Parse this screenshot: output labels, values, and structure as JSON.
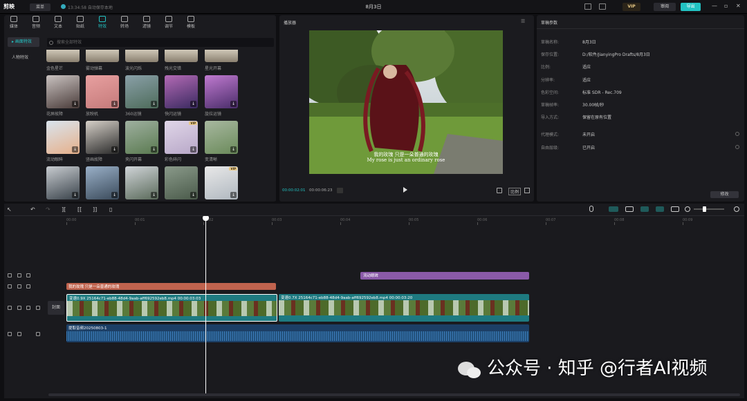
{
  "app": {
    "logo": "剪映",
    "menu_label": "菜单",
    "autosave": "13:34:58 自动保存本地",
    "window_title": "8月3日",
    "vip": "VIP",
    "review": "审阅",
    "export": "导出"
  },
  "top_tabs": [
    {
      "label": "媒体",
      "icon": "media-icon"
    },
    {
      "label": "音频",
      "icon": "audio-icon"
    },
    {
      "label": "文本",
      "icon": "text-icon"
    },
    {
      "label": "贴纸",
      "icon": "sticker-icon"
    },
    {
      "label": "特效",
      "icon": "effects-icon",
      "active": true
    },
    {
      "label": "转场",
      "icon": "transition-icon"
    },
    {
      "label": "滤镜",
      "icon": "filter-icon"
    },
    {
      "label": "调节",
      "icon": "adjust-icon"
    },
    {
      "label": "模板",
      "icon": "template-icon"
    }
  ],
  "left_nav": [
    {
      "label": "▸ 画面特效",
      "active": true
    },
    {
      "label": "人物特效"
    }
  ],
  "search": {
    "placeholder": "搜索全部特效"
  },
  "effects_top_labels": [
    "金色星芒",
    "雾动弹幕",
    "波光闪烁",
    "残光交错",
    "星光开幕"
  ],
  "effects": [
    {
      "label": "花屏故障",
      "colors": [
        "#c9c2c0",
        "#4a3c3a"
      ],
      "vip": false
    },
    {
      "label": "放映机",
      "colors": [
        "#e8a0a0",
        "#c47a7a"
      ],
      "vip": false
    },
    {
      "label": "360运镜",
      "colors": [
        "#8aa0a8",
        "#4d6b5a"
      ],
      "vip": false
    },
    {
      "label": "快闪运镜",
      "colors": [
        "#b36ab5",
        "#3a2a60"
      ],
      "vip": false
    },
    {
      "label": "旋拉运镜",
      "colors": [
        "#c07ad0",
        "#4a2d6a"
      ],
      "vip": false
    },
    {
      "label": "流动眼眸",
      "colors": [
        "#d9e4ee",
        "#e6b08a"
      ],
      "vip": false
    },
    {
      "label": "竖画故障",
      "colors": [
        "#d6d0c8",
        "#2a2a2a"
      ],
      "vip": false
    },
    {
      "label": "夹闪开幕",
      "colors": [
        "#9fb0a0",
        "#5a7a50"
      ],
      "vip": false
    },
    {
      "label": "彩色碎闪",
      "colors": [
        "#e0d6e8",
        "#b8a8c8"
      ],
      "vip": true
    },
    {
      "label": "变清晰",
      "colors": [
        "#a8b8a0",
        "#6a8a5a"
      ],
      "vip": false
    },
    {
      "label": "",
      "colors": [
        "#c8ccd0",
        "#39424a"
      ],
      "vip": false
    },
    {
      "label": "",
      "colors": [
        "#9ab0c8",
        "#3a4a5a"
      ],
      "vip": false
    },
    {
      "label": "",
      "colors": [
        "#d0d4d8",
        "#5a6a5a"
      ],
      "vip": false
    },
    {
      "label": "",
      "colors": [
        "#8a9a8a",
        "#4a5a4a"
      ],
      "vip": false
    },
    {
      "label": "",
      "colors": [
        "#e8e8e8",
        "#b0b8c0"
      ],
      "vip": true
    }
  ],
  "player": {
    "title": "播放器",
    "subtitle_cn": "我的玫瑰 只是一朵普通的玫瑰",
    "subtitle_en": "My rose is just an ordinary rose",
    "current_time": "00:00:02:01",
    "total_time": "00:00:06:23",
    "ratio_label": "比例"
  },
  "props": {
    "title": "草稿参数",
    "rows": [
      {
        "label": "草稿名称:",
        "value": "8月3日"
      },
      {
        "label": "保存位置:",
        "value": "D:/软件/JianyingPro Drafts/8月3日"
      },
      {
        "label": "比例:",
        "value": "适应"
      },
      {
        "label": "分辨率:",
        "value": "适应"
      },
      {
        "label": "色彩空间:",
        "value": "标准 SDR - Rec.709"
      },
      {
        "label": "草稿帧率:",
        "value": "30.00帧/秒"
      },
      {
        "label": "导入方式:",
        "value": "保留在原有位置"
      }
    ],
    "rows2": [
      {
        "label": "代理模式:",
        "value": "未开启"
      },
      {
        "label": "自由层级:",
        "value": "已开启"
      }
    ],
    "modify": "修改"
  },
  "timeline": {
    "ticks": [
      "00:00",
      "00:01",
      "00:02",
      "00:03",
      "00:04",
      "00:05",
      "00:06",
      "00:07",
      "00:08",
      "00:09"
    ],
    "effect_clip": "流动眼眸",
    "text_clip": "我的玫瑰 只是一朵普通的玫瑰",
    "video_clip_1": "变速0.9X  25164c71-eb88-48d4-9aab-aff692592eb8.mp4  00:00:03:03",
    "video_clip_2": "变速0.7X  25164c71-eb88-48d4-9aab-aff692592eb8.mp4  00:00:03:20",
    "audio_clip": "提取音频20250803-1",
    "cover": "封面"
  },
  "watermark": {
    "text": "公众号 · 知乎 @行者AI视频"
  }
}
